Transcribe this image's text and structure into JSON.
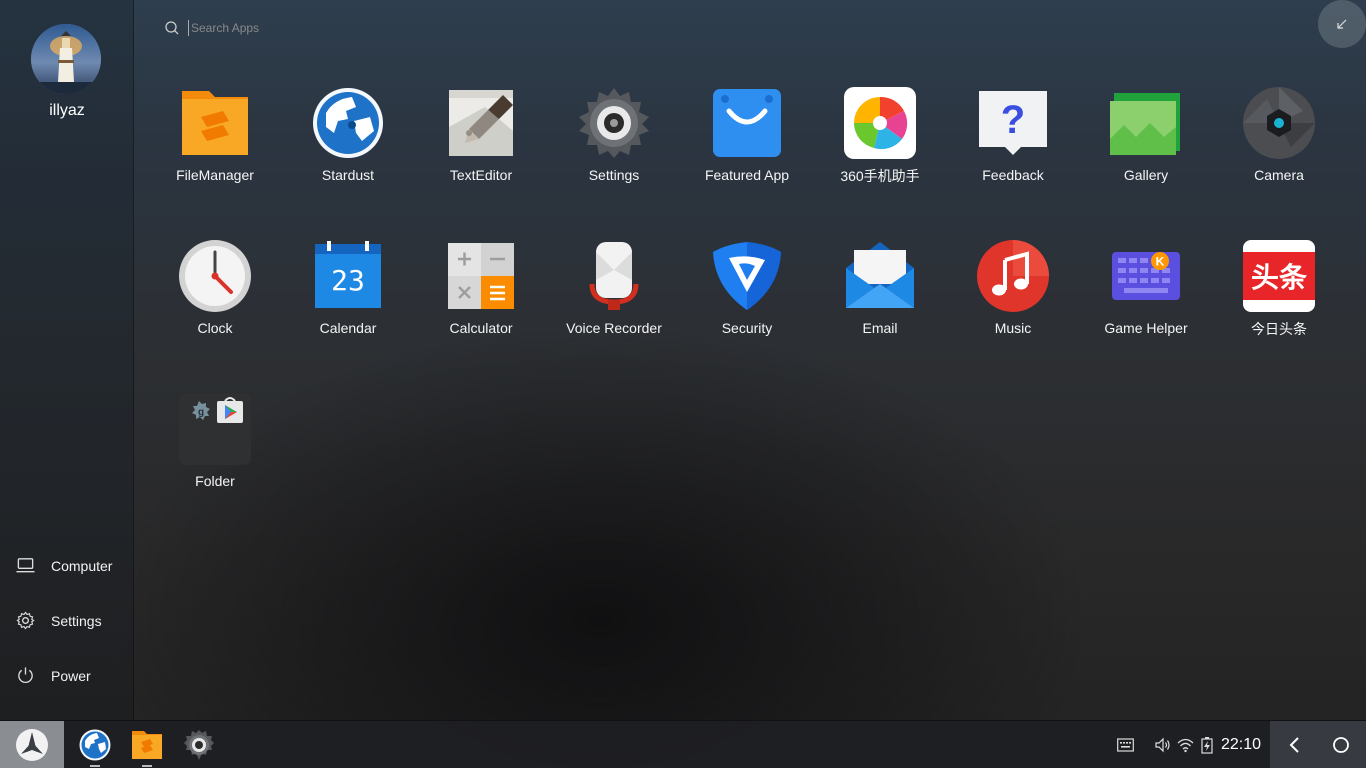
{
  "user": {
    "name": "illyaz"
  },
  "sidebar": {
    "links": [
      {
        "label": "Computer",
        "icon": "laptop-icon"
      },
      {
        "label": "Settings",
        "icon": "gear-icon"
      },
      {
        "label": "Power",
        "icon": "power-icon"
      }
    ]
  },
  "search": {
    "placeholder": "Search Apps"
  },
  "apps": [
    {
      "label": "FileManager",
      "icon": "file-manager-icon"
    },
    {
      "label": "Stardust",
      "icon": "stardust-globe-icon"
    },
    {
      "label": "TextEditor",
      "icon": "text-editor-icon"
    },
    {
      "label": "Settings",
      "icon": "settings-gear-icon"
    },
    {
      "label": "Featured App",
      "icon": "shopping-bag-icon"
    },
    {
      "label": "360手机助手",
      "icon": "360-assistant-icon"
    },
    {
      "label": "Feedback",
      "icon": "feedback-question-icon"
    },
    {
      "label": "Gallery",
      "icon": "gallery-icon"
    },
    {
      "label": "Camera",
      "icon": "camera-icon"
    },
    {
      "label": "Clock",
      "icon": "clock-icon"
    },
    {
      "label": "Calendar",
      "icon": "calendar-icon",
      "day": "23"
    },
    {
      "label": "Calculator",
      "icon": "calculator-icon"
    },
    {
      "label": "Voice Recorder",
      "icon": "voice-recorder-icon"
    },
    {
      "label": "Security",
      "icon": "security-shield-icon"
    },
    {
      "label": "Email",
      "icon": "email-envelope-icon"
    },
    {
      "label": "Music",
      "icon": "music-note-icon"
    },
    {
      "label": "Game Helper",
      "icon": "game-keyboard-icon"
    },
    {
      "label": "今日头条",
      "icon": "toutiao-icon",
      "badge_text": "头条"
    },
    {
      "label": "Folder",
      "icon": "folder-icon"
    }
  ],
  "taskbar": {
    "pinned": [
      "stardust-globe-icon",
      "file-manager-icon",
      "settings-gear-icon"
    ],
    "time": "22:10",
    "tray_icons": [
      "keyboard-icon",
      "volume-icon",
      "wifi-icon",
      "battery-icon"
    ]
  },
  "colors": {
    "filemanager": "#f7a21b",
    "featured": "#2f8ff0",
    "music": "#e0352b",
    "toutiao": "#e8262a",
    "gamehelper": "#5b4fe0",
    "security": "#1f7ef0"
  }
}
